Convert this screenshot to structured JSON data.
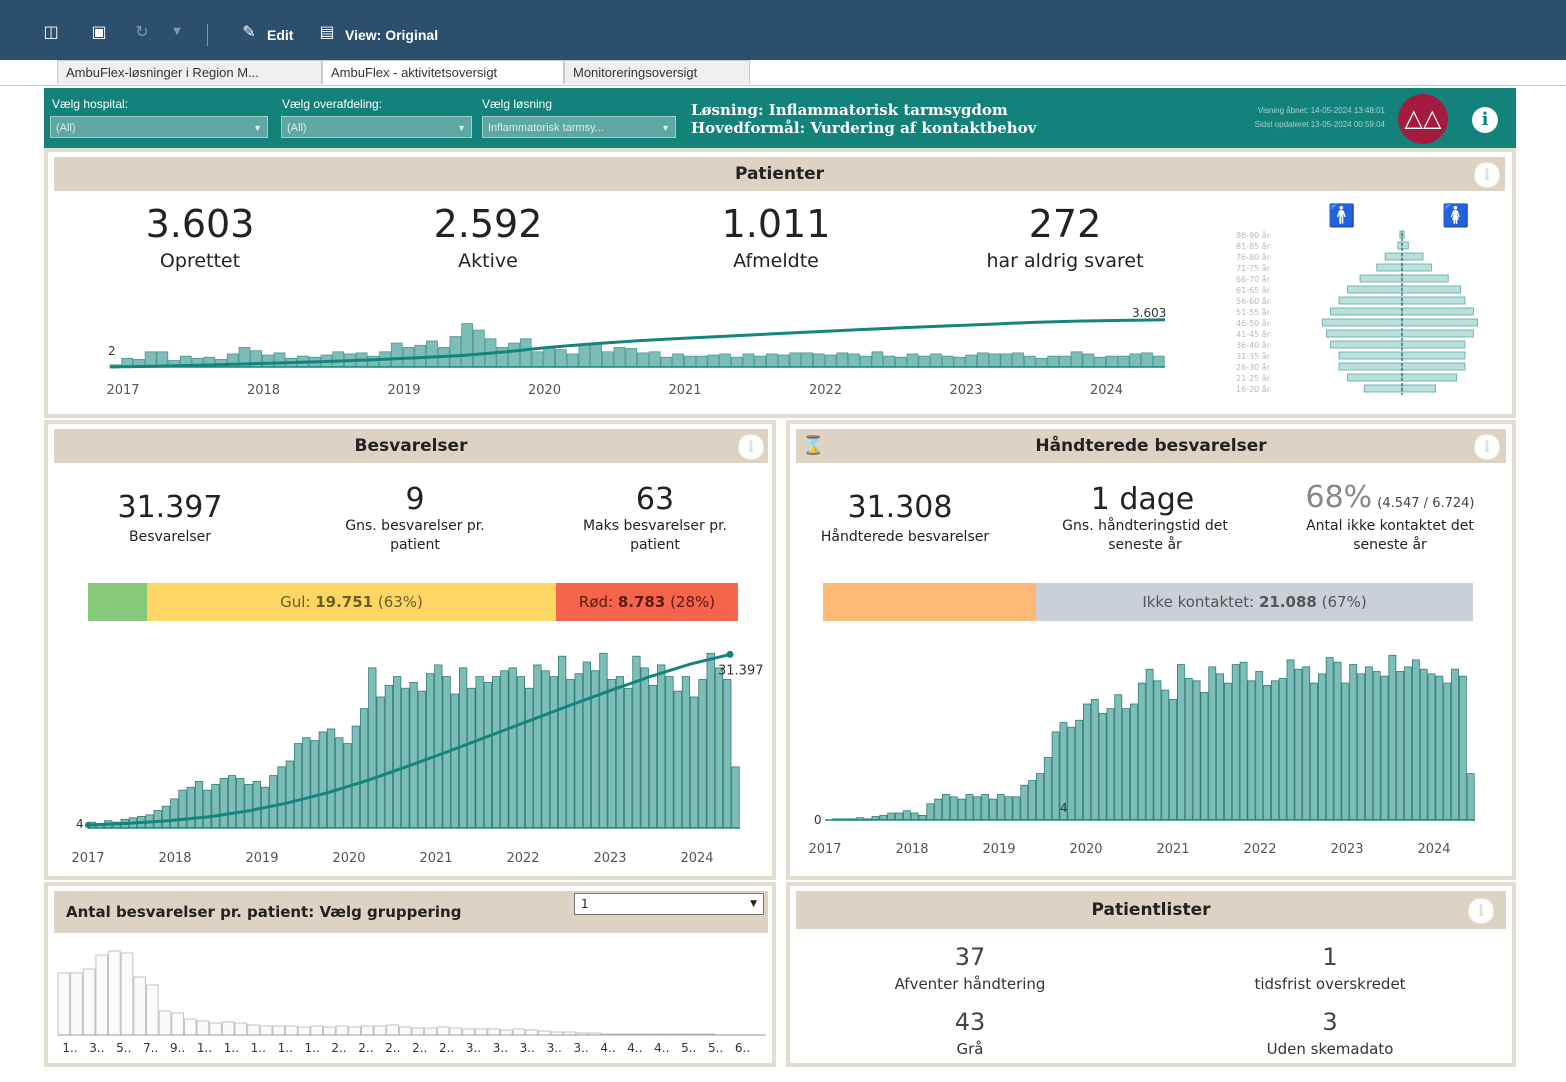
{
  "toolbar": {
    "edit_label": "Edit",
    "view_label": "View: Original"
  },
  "tabs": [
    {
      "label": "AmbuFlex-løsninger i Region M..."
    },
    {
      "label": "AmbuFlex - aktivitetsoversigt"
    },
    {
      "label": "Monitoreringsoversigt"
    }
  ],
  "filters": {
    "hospital": {
      "label": "Vælg hospital:",
      "value": "(All)"
    },
    "overafdeling": {
      "label": "Vælg overafdeling:",
      "value": "(All)"
    },
    "losning": {
      "label": "Vælg løsning",
      "value": "Inflammatorisk tarmsy..."
    }
  },
  "header": {
    "solution": "Løsning: Inflammatorisk tarmsygdom",
    "purpose": "Hovedformål: Vurdering af kontaktbehov",
    "opened": "Visning åbnet: 14-05-2024 13:48:01",
    "updated": "Sidst opdateret 13-05-2024 00:59:04"
  },
  "colors": {
    "accent": "#12827b",
    "panel_title": "#ddd3c4",
    "bar": "#7cbdb7",
    "line": "#14857d",
    "green": "#86c97a",
    "yellow": "#fdd663",
    "red": "#f4654b",
    "orange": "#ffb977",
    "grey": "#c9d0d8"
  },
  "patienter": {
    "title": "Patienter",
    "kpis": [
      {
        "value": "3.603",
        "label": "Oprettet"
      },
      {
        "value": "2.592",
        "label": "Aktive"
      },
      {
        "value": "1.011",
        "label": "Afmeldte"
      },
      {
        "value": "272",
        "label": "har aldrig svaret"
      }
    ]
  },
  "besvarelser": {
    "title": "Besvarelser",
    "total": {
      "value": "31.397",
      "label": "Besvarelser"
    },
    "avg": {
      "value": "9",
      "label": "Gns. besvarelser pr. patient"
    },
    "max": {
      "value": "63",
      "label": "Maks besvarelser pr. patient"
    },
    "bar": {
      "yellow_prefix": "Gul: ",
      "yellow_value": "19.751",
      "yellow_pct": " (63%)",
      "red_prefix": "Rød: ",
      "red_value": "8.783",
      "red_pct": " (28%)",
      "green_frac": 0.09,
      "yellow_frac": 0.63,
      "red_frac": 0.28
    }
  },
  "haandterede": {
    "title": "Håndterede besvarelser",
    "total": {
      "value": "31.308",
      "label": "Håndterede besvarelser"
    },
    "avg": {
      "value": "1 dage",
      "label": "Gns. håndteringstid det seneste år"
    },
    "pct": {
      "value": "68%",
      "sub": "(4.547 / 6.724)",
      "label": "Antal ikke kontaktet det seneste år"
    },
    "bar": {
      "grey_prefix": "Ikke kontaktet: ",
      "grey_value": "21.088",
      "grey_pct": " (67%)",
      "orange_frac": 0.33,
      "grey_frac": 0.67
    }
  },
  "gruppering": {
    "title": "Antal besvarelser pr. patient: Vælg gruppering",
    "select_value": "1"
  },
  "patientlister": {
    "title": "Patientlister",
    "items": [
      {
        "value": "37",
        "label": "Afventer håndtering"
      },
      {
        "value": "1",
        "label": "tidsfrist overskredet"
      },
      {
        "value": "43",
        "label": "Grå"
      },
      {
        "value": "3",
        "label": "Uden skemadato"
      }
    ]
  },
  "chart_data": [
    {
      "id": "patients",
      "type": "bar",
      "x_tick_labels": [
        "2017",
        "2018",
        "2019",
        "2020",
        "2021",
        "2022",
        "2023",
        "2024"
      ],
      "values": [
        2,
        8,
        7,
        14,
        14,
        6,
        10,
        8,
        9,
        7,
        12,
        18,
        15,
        11,
        13,
        8,
        10,
        9,
        11,
        14,
        12,
        13,
        10,
        14,
        22,
        18,
        20,
        24,
        18,
        28,
        40,
        34,
        26,
        18,
        22,
        26,
        14,
        18,
        16,
        12,
        20,
        22,
        14,
        18,
        17,
        13,
        14,
        9,
        12,
        10,
        10,
        11,
        12,
        9,
        12,
        10,
        12,
        11,
        13,
        13,
        12,
        11,
        13,
        12,
        10,
        14,
        10,
        9,
        12,
        10,
        12,
        10,
        9,
        11,
        13,
        12,
        12,
        13,
        10,
        8,
        10,
        10,
        14,
        12,
        9,
        10,
        10,
        12,
        13,
        10
      ],
      "line_start_label": "2",
      "line_end_label": "3.603",
      "cumulative": [
        2,
        60,
        130,
        230,
        330,
        430,
        560,
        700,
        880,
        1150,
        1500,
        1780,
        2000,
        2180,
        2350,
        2520,
        2680,
        2840,
        2990,
        3130,
        3270,
        3400,
        3500,
        3560,
        3603
      ]
    },
    {
      "id": "age_pyramid",
      "type": "bar",
      "categories": [
        "86-90 år",
        "81-85 år",
        "76-80 år",
        "71-75 år",
        "66-70 år",
        "61-65 år",
        "56-60 år",
        "51-55 år",
        "46-50 år",
        "41-45 år",
        "36-40 år",
        "31-35 år",
        "26-30 år",
        "21-25 år",
        "16-20 år"
      ],
      "series": [
        {
          "values": [
            1,
            2,
            8,
            12,
            20,
            26,
            30,
            34,
            38,
            36,
            34,
            30,
            30,
            26,
            18
          ]
        },
        {
          "values": [
            1,
            3,
            10,
            14,
            22,
            28,
            30,
            34,
            36,
            34,
            30,
            30,
            30,
            26,
            16
          ]
        }
      ]
    },
    {
      "id": "responses",
      "type": "bar",
      "x_tick_labels": [
        "2017",
        "2018",
        "2019",
        "2020",
        "2021",
        "2022",
        "2023",
        "2024"
      ],
      "values": [
        4,
        3,
        5,
        4,
        6,
        7,
        8,
        9,
        12,
        15,
        20,
        26,
        28,
        32,
        26,
        30,
        34,
        36,
        34,
        30,
        32,
        28,
        36,
        42,
        46,
        58,
        62,
        60,
        66,
        68,
        62,
        58,
        70,
        82,
        110,
        90,
        98,
        104,
        96,
        100,
        94,
        106,
        112,
        104,
        92,
        110,
        96,
        104,
        100,
        104,
        108,
        110,
        104,
        96,
        112,
        108,
        104,
        118,
        102,
        106,
        114,
        108,
        120,
        102,
        104,
        96,
        118,
        110,
        98,
        112,
        104,
        94,
        104,
        90,
        102,
        120,
        110,
        102,
        42
      ],
      "line_start_label": "4",
      "line_end_label": "31.397",
      "cumulative": [
        4,
        300,
        800,
        1500,
        2600,
        4100,
        6000,
        8300,
        10900,
        13600,
        16400,
        19200,
        22000,
        24700,
        27300,
        29600,
        31397
      ]
    },
    {
      "id": "handled",
      "type": "bar",
      "x_tick_labels": [
        "2017",
        "2018",
        "2019",
        "2020",
        "2021",
        "2022",
        "2023",
        "2024"
      ],
      "values": [
        0,
        1,
        1,
        1,
        2,
        1,
        3,
        4,
        6,
        6,
        8,
        6,
        4,
        14,
        18,
        22,
        20,
        18,
        22,
        20,
        22,
        18,
        22,
        20,
        20,
        30,
        34,
        40,
        54,
        76,
        84,
        80,
        86,
        100,
        104,
        92,
        96,
        108,
        96,
        100,
        118,
        130,
        120,
        112,
        104,
        134,
        122,
        120,
        110,
        132,
        126,
        118,
        134,
        136,
        120,
        128,
        116,
        120,
        122,
        138,
        130,
        132,
        118,
        126,
        140,
        136,
        118,
        134,
        126,
        132,
        128,
        124,
        142,
        128,
        132,
        138,
        130,
        126,
        124,
        118,
        130,
        124,
        40
      ],
      "line_start_label": "0",
      "mid_label": "4"
    },
    {
      "id": "per_patient",
      "type": "bar",
      "x_tick_labels": [
        "1..",
        "3..",
        "5..",
        "7..",
        "9..",
        "1..",
        "1..",
        "1..",
        "1..",
        "1..",
        "2..",
        "2..",
        "2..",
        "2..",
        "2..",
        "3..",
        "3..",
        "3..",
        "3..",
        "3..",
        "4..",
        "4..",
        "4..",
        "5..",
        "5..",
        "6.."
      ],
      "values": [
        62,
        62,
        66,
        80,
        84,
        82,
        58,
        50,
        24,
        22,
        16,
        14,
        12,
        13,
        12,
        10,
        9,
        9,
        9,
        8,
        9,
        8,
        9,
        8,
        9,
        9,
        10,
        8,
        7,
        7,
        8,
        7,
        6,
        6,
        6,
        5,
        6,
        5,
        4,
        3,
        3,
        2,
        2,
        1,
        1,
        1,
        1,
        1,
        1,
        1,
        1,
        1,
        0,
        0,
        0,
        0
      ]
    }
  ]
}
